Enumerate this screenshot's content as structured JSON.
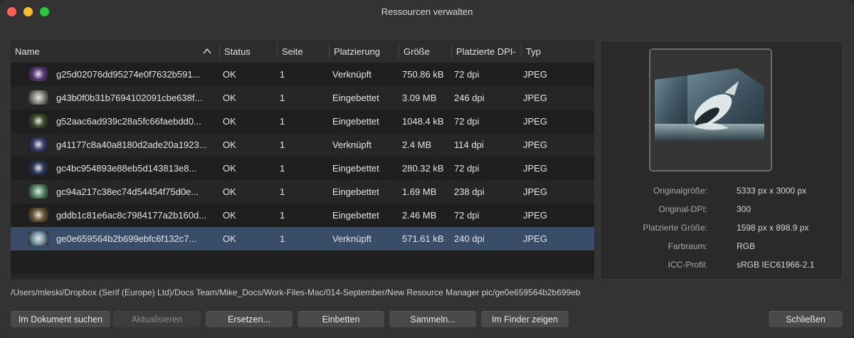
{
  "window": {
    "title": "Ressourcen verwalten"
  },
  "columns": {
    "name": "Name",
    "status": "Status",
    "page": "Seite",
    "placement": "Platzierung",
    "size": "Größe",
    "dpi": "Platzierte DPI-",
    "type": "Typ"
  },
  "sort": {
    "column": "Name",
    "direction": "ascending",
    "icon": "chevron-up-icon"
  },
  "rows": [
    {
      "name": "g25d02076dd95274e0f7632b591...",
      "status": "OK",
      "page": "1",
      "placement": "Verknüpft",
      "size": "750.86 kB",
      "dpi": "72 dpi",
      "type": "JPEG"
    },
    {
      "name": "g43b0f0b31b7694102091cbe638f...",
      "status": "OK",
      "page": "1",
      "placement": "Eingebettet",
      "size": "3.09 MB",
      "dpi": "246 dpi",
      "type": "JPEG"
    },
    {
      "name": "g52aac6ad939c28a5fc66faebdd0...",
      "status": "OK",
      "page": "1",
      "placement": "Eingebettet",
      "size": "1048.4 kB",
      "dpi": "72 dpi",
      "type": "JPEG"
    },
    {
      "name": "g41177c8a40a8180d2ade20a1923...",
      "status": "OK",
      "page": "1",
      "placement": "Verknüpft",
      "size": "2.4 MB",
      "dpi": "114 dpi",
      "type": "JPEG"
    },
    {
      "name": "gc4bc954893e88eb5d143813e8...",
      "status": "OK",
      "page": "1",
      "placement": "Eingebettet",
      "size": "280.32 kB",
      "dpi": "72 dpi",
      "type": "JPEG"
    },
    {
      "name": "gc94a217c38ec74d54454f75d0e...",
      "status": "OK",
      "page": "1",
      "placement": "Eingebettet",
      "size": "1.69 MB",
      "dpi": "238 dpi",
      "type": "JPEG"
    },
    {
      "name": "gddb1c81e6ac8c7984177a2b160d...",
      "status": "OK",
      "page": "1",
      "placement": "Eingebettet",
      "size": "2.46 MB",
      "dpi": "72 dpi",
      "type": "JPEG"
    },
    {
      "name": "ge0e659564b2b699ebfc6f132c7...",
      "status": "OK",
      "page": "1",
      "placement": "Verknüpft",
      "size": "571.61 kB",
      "dpi": "240 dpi",
      "type": "JPEG"
    }
  ],
  "selected_row": 8,
  "thumb_colors": [
    "#5a3a7a",
    "#8a8a84",
    "#3b4a2a",
    "#3a3a6a",
    "#2a3a5a",
    "#5a8a6a",
    "#6a5a3a",
    "#7a9aa8"
  ],
  "details": {
    "original_size_label": "Originalgröße:",
    "original_size": "5333 px x 3000 px",
    "original_dpi_label": "Original-DPI:",
    "original_dpi": "300",
    "placed_size_label": "Platzierte Größe:",
    "placed_size": "1598 px x 898.9 px",
    "color_space_label": "Farbraum:",
    "color_space": "RGB",
    "icc_label": "ICC-Profil:",
    "icc": "sRGB IEC61966-2.1"
  },
  "path": "/Users/mleski/Dropbox (Serif (Europe) Ltd)/Docs Team/Mike_Docs/Work-Files-Mac/014-September/New Resource Manager pic/ge0e659564b2b699eb",
  "buttons": {
    "find": "Im Dokument suchen",
    "update": "Aktualisieren",
    "replace": "Ersetzen...",
    "embed": "Einbetten",
    "collect": "Sammeln...",
    "finder": "Im Finder zeigen",
    "close": "Schließen"
  }
}
